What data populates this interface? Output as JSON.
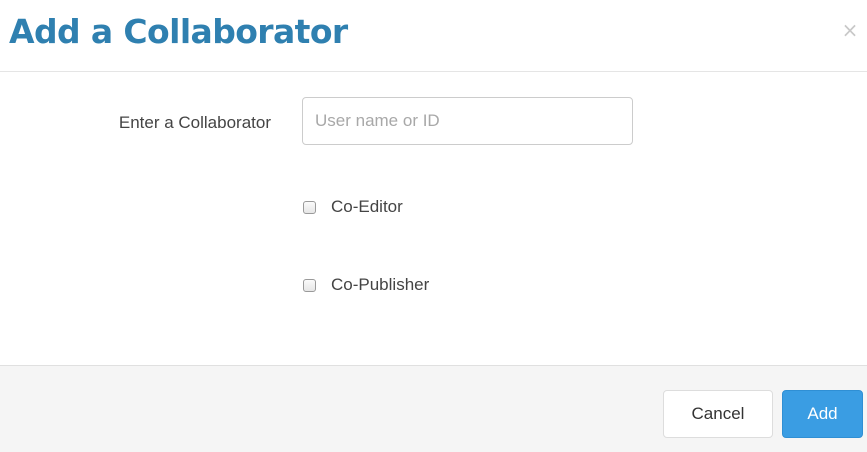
{
  "dialog": {
    "title": "Add a Collaborator",
    "close_label": "×"
  },
  "form": {
    "collaborator_label": "Enter a Collaborator",
    "collaborator_value": "",
    "collaborator_placeholder": "User name or ID",
    "options": [
      {
        "label": "Co-Editor",
        "checked": false
      },
      {
        "label": "Co-Publisher",
        "checked": false
      }
    ]
  },
  "footer": {
    "cancel_label": "Cancel",
    "add_label": "Add"
  },
  "colors": {
    "title": "#2f80b0",
    "primary_button": "#3a9de3",
    "footer_bg": "#f5f5f5"
  }
}
